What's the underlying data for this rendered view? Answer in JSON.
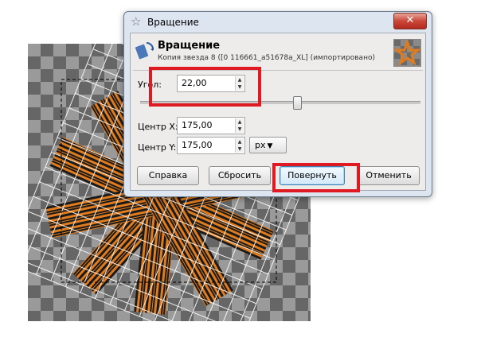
{
  "window": {
    "title": "Вращение",
    "icons": {
      "title": "star-icon",
      "close": "close-icon",
      "header": "rotate-tool-icon"
    }
  },
  "header": {
    "title": "Вращение",
    "subtitle": "Копия звезда 8 ([0 116661_a51678a_XL] (импортировано)"
  },
  "fields": {
    "angle_label": "Угол:",
    "angle_value": "22,00",
    "center_x_label": "Центр X:",
    "center_x_value": "175,00",
    "center_y_label": "Центр Y:",
    "center_y_value": "175,00",
    "unit_value": "px"
  },
  "slider": {
    "fraction": 0.56
  },
  "buttons": {
    "help": "Справка",
    "reset": "Сбросить",
    "rotate": "Повернуть",
    "cancel": "Отменить"
  },
  "colors": {
    "highlight": "#e01a22",
    "ribbon_orange": "#e07b1e",
    "ribbon_stripe": "#1a1a1a"
  }
}
